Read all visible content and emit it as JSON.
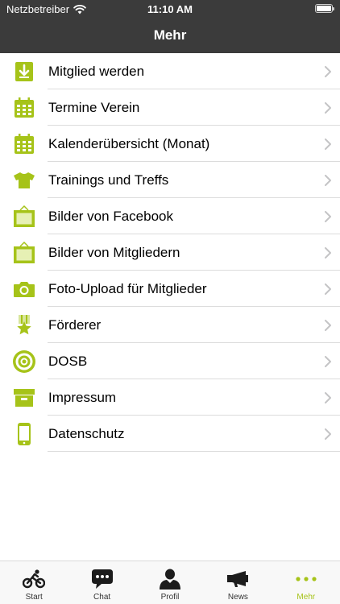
{
  "status_bar": {
    "carrier": "Netzbetreiber",
    "time": "11:10 AM"
  },
  "header": {
    "title": "Mehr"
  },
  "colors": {
    "accent": "#a6c319",
    "bar": "#3b3b3b"
  },
  "menu": [
    {
      "label": "Mitglied werden",
      "icon": "download-icon"
    },
    {
      "label": "Termine Verein",
      "icon": "calendar-icon"
    },
    {
      "label": "Kalenderübersicht (Monat)",
      "icon": "calendar-icon"
    },
    {
      "label": "Trainings und Treffs",
      "icon": "tshirt-icon"
    },
    {
      "label": "Bilder von Facebook",
      "icon": "picture-frame-icon"
    },
    {
      "label": "Bilder von Mitgliedern",
      "icon": "picture-frame-icon"
    },
    {
      "label": "Foto-Upload für Mitglieder",
      "icon": "camera-icon"
    },
    {
      "label": "Förderer",
      "icon": "medal-icon"
    },
    {
      "label": "DOSB",
      "icon": "target-icon"
    },
    {
      "label": "Impressum",
      "icon": "archive-box-icon"
    },
    {
      "label": "Datenschutz",
      "icon": "smartphone-icon"
    }
  ],
  "tabs": [
    {
      "label": "Start",
      "icon": "cyclist-icon"
    },
    {
      "label": "Chat",
      "icon": "chat-bubble-icon"
    },
    {
      "label": "Profil",
      "icon": "person-icon"
    },
    {
      "label": "News",
      "icon": "megaphone-icon"
    },
    {
      "label": "Mehr",
      "icon": "more-dots-icon",
      "active": true
    }
  ]
}
